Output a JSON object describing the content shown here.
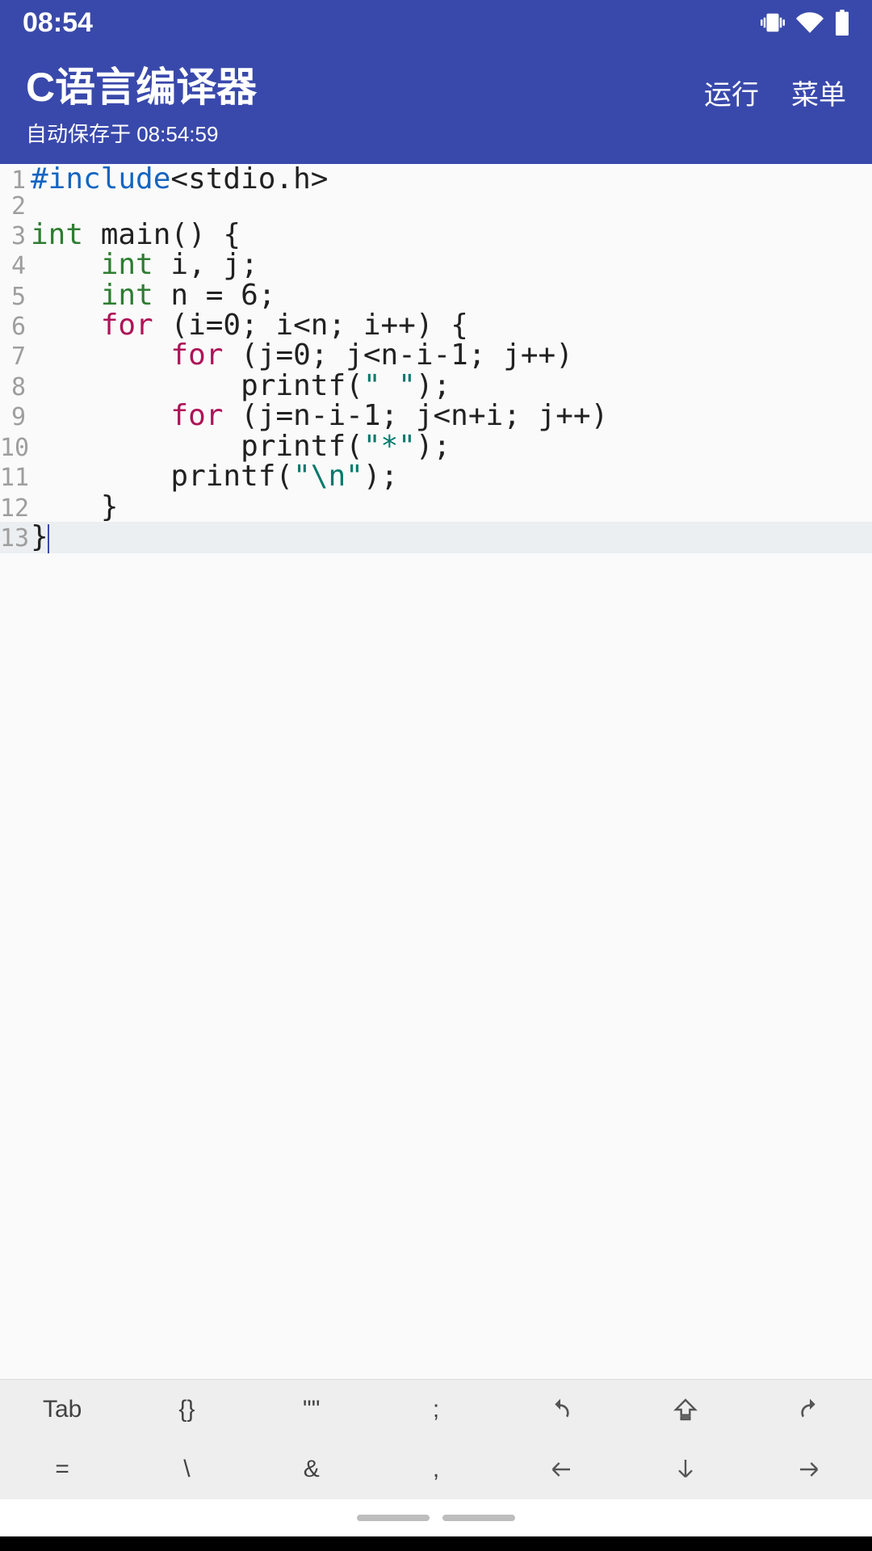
{
  "statusBar": {
    "time": "08:54"
  },
  "appBar": {
    "title": "C语言编译器",
    "subtitle": "自动保存于 08:54:59",
    "actions": {
      "run": "运行",
      "menu": "菜单"
    }
  },
  "editor": {
    "cursorLine": 13,
    "lines": [
      {
        "n": 1,
        "tokens": [
          {
            "t": "#include",
            "c": "kw-pre"
          },
          {
            "t": "<stdio.h>",
            "c": ""
          }
        ]
      },
      {
        "n": 2,
        "tokens": []
      },
      {
        "n": 3,
        "tokens": [
          {
            "t": "int",
            "c": "kw-type"
          },
          {
            "t": " main() {",
            "c": ""
          }
        ]
      },
      {
        "n": 4,
        "tokens": [
          {
            "t": "    ",
            "c": ""
          },
          {
            "t": "int",
            "c": "kw-type"
          },
          {
            "t": " i, j;",
            "c": ""
          }
        ]
      },
      {
        "n": 5,
        "tokens": [
          {
            "t": "    ",
            "c": ""
          },
          {
            "t": "int",
            "c": "kw-type"
          },
          {
            "t": " n = 6;",
            "c": ""
          }
        ]
      },
      {
        "n": 6,
        "tokens": [
          {
            "t": "    ",
            "c": ""
          },
          {
            "t": "for",
            "c": "kw-ctrl"
          },
          {
            "t": " (i=0; i<n; i++) {",
            "c": ""
          }
        ]
      },
      {
        "n": 7,
        "tokens": [
          {
            "t": "        ",
            "c": ""
          },
          {
            "t": "for",
            "c": "kw-ctrl"
          },
          {
            "t": " (j=0; j<n-i-1; j++)",
            "c": ""
          }
        ]
      },
      {
        "n": 8,
        "tokens": [
          {
            "t": "            printf(",
            "c": ""
          },
          {
            "t": "\" \"",
            "c": "str"
          },
          {
            "t": ");",
            "c": ""
          }
        ]
      },
      {
        "n": 9,
        "tokens": [
          {
            "t": "        ",
            "c": ""
          },
          {
            "t": "for",
            "c": "kw-ctrl"
          },
          {
            "t": " (j=n-i-1; j<n+i; j++)",
            "c": ""
          }
        ]
      },
      {
        "n": 10,
        "tokens": [
          {
            "t": "            printf(",
            "c": ""
          },
          {
            "t": "\"*\"",
            "c": "str"
          },
          {
            "t": ");",
            "c": ""
          }
        ]
      },
      {
        "n": 11,
        "tokens": [
          {
            "t": "        printf(",
            "c": ""
          },
          {
            "t": "\"\\n\"",
            "c": "str"
          },
          {
            "t": ");",
            "c": ""
          }
        ]
      },
      {
        "n": 12,
        "tokens": [
          {
            "t": "    }",
            "c": ""
          }
        ]
      },
      {
        "n": 13,
        "tokens": [
          {
            "t": "}",
            "c": ""
          }
        ]
      }
    ]
  },
  "toolbar": {
    "row1": [
      "Tab",
      "{}",
      "\"\"",
      ";",
      "undo-icon",
      "shift-up-icon",
      "redo-icon"
    ],
    "row2": [
      "=",
      "\\",
      "&",
      ",",
      "arrow-left-icon",
      "arrow-down-icon",
      "arrow-right-icon"
    ]
  }
}
